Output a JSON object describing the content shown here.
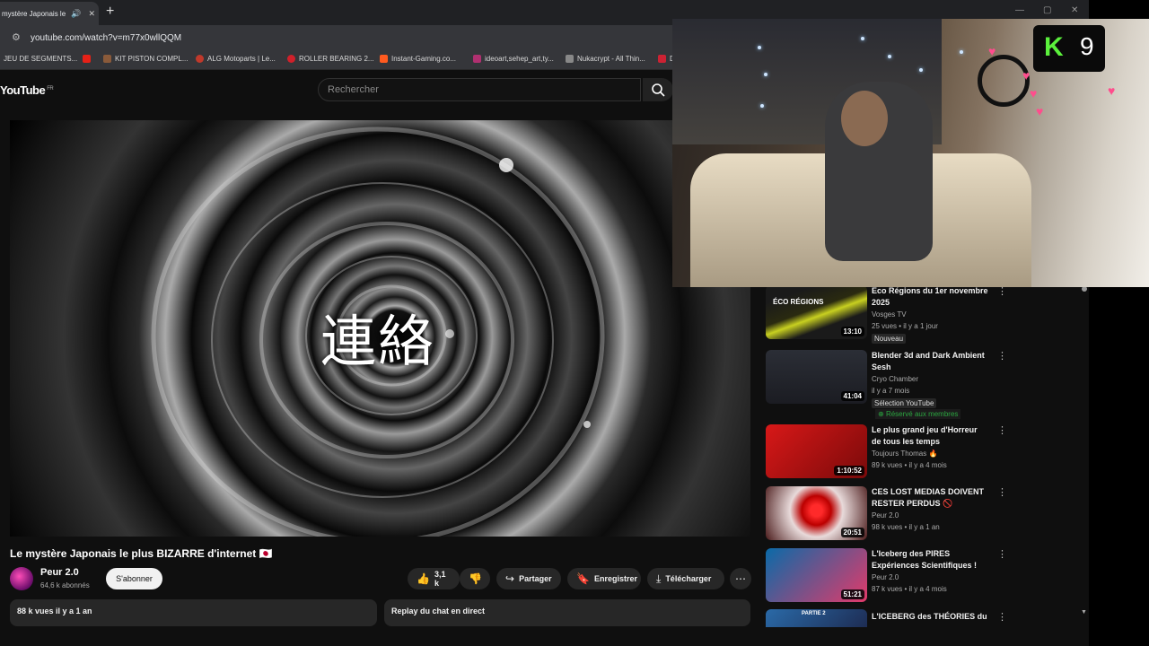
{
  "browser": {
    "tab_title": "mystère Japonais le p",
    "new_tab": "+",
    "url": "youtube.com/watch?v=m77x0wllQQM",
    "window_controls": [
      "—",
      "▢",
      "✕"
    ],
    "bookmarks": [
      {
        "label": "JEU DE SEGMENTS...",
        "color": "#666666"
      },
      {
        "label": "",
        "color": "#e62117"
      },
      {
        "label": "KIT PISTON COMPL...",
        "color": "#8a5a3a"
      },
      {
        "label": "ALG Motoparts | Le...",
        "color": "#c0392b"
      },
      {
        "label": "ROLLER BEARING 2...",
        "color": "#d0202a"
      },
      {
        "label": "Instant-Gaming.co...",
        "color": "#ff5a1f"
      },
      {
        "label": "ideoart,sehep_art,ty...",
        "color": "#b03070"
      },
      {
        "label": "Nukacrypt - All Thin...",
        "color": "#888888"
      },
      {
        "label": "D",
        "color": "#cc2233"
      }
    ]
  },
  "youtube": {
    "logo": "YouTube",
    "logo_region": "FR",
    "search_placeholder": "Rechercher",
    "video_overlay_text": "連絡",
    "video_title": "Le mystère Japonais le plus BIZARRE d'internet 🇯🇵",
    "channel_name": "Peur 2.0",
    "subscribers": "64,6 k abonnés",
    "subscribe_label": "S'abonner",
    "likes": "3,1 k",
    "share_label": "Partager",
    "save_label": "Enregistrer",
    "download_label": "Télécharger",
    "description_meta": "88 k vues  il y a 1 an",
    "chat_replay_label": "Replay du chat en direct"
  },
  "recommendations": [
    {
      "title": "Éco Régions du 1er novembre 2025",
      "channel": "Vosges TV",
      "meta": "25 vues • il y a 1 jour",
      "badge": "Nouveau",
      "member": "",
      "duration": "13:10",
      "thumb_text": "ÉCO RÉGIONS"
    },
    {
      "title": "Blender 3d and Dark Ambient Sesh",
      "channel": "Cryo Chamber",
      "meta": "il y a 7 mois",
      "badge": "Sélection YouTube",
      "member": "Réservé aux membres",
      "duration": "41:04",
      "thumb_text": ""
    },
    {
      "title": "Le plus grand jeu d'Horreur de tous les temps",
      "channel": "Toujours Thomas 🔥",
      "meta": "89 k vues • il y a 4 mois",
      "badge": "",
      "member": "",
      "duration": "1:10:52",
      "thumb_text": ""
    },
    {
      "title": "CES LOST MEDIAS DOIVENT RESTER PERDUS 🚫",
      "channel": "Peur 2.0",
      "meta": "98 k vues • il y a 1 an",
      "badge": "",
      "member": "",
      "duration": "20:51",
      "thumb_text": ""
    },
    {
      "title": "L'Iceberg des PIRES Expériences Scientifiques !",
      "channel": "Peur 2.0",
      "meta": "87 k vues • il y a 4 mois",
      "badge": "",
      "member": "",
      "duration": "51:21",
      "thumb_text": ""
    },
    {
      "title": "L'ICEBERG des THÉORIES du",
      "channel": "",
      "meta": "",
      "badge": "",
      "member": "",
      "duration": "",
      "thumb_text": "PARTIE 2"
    }
  ],
  "overlay": {
    "logo_letter": "K",
    "logo_mark": "9"
  }
}
